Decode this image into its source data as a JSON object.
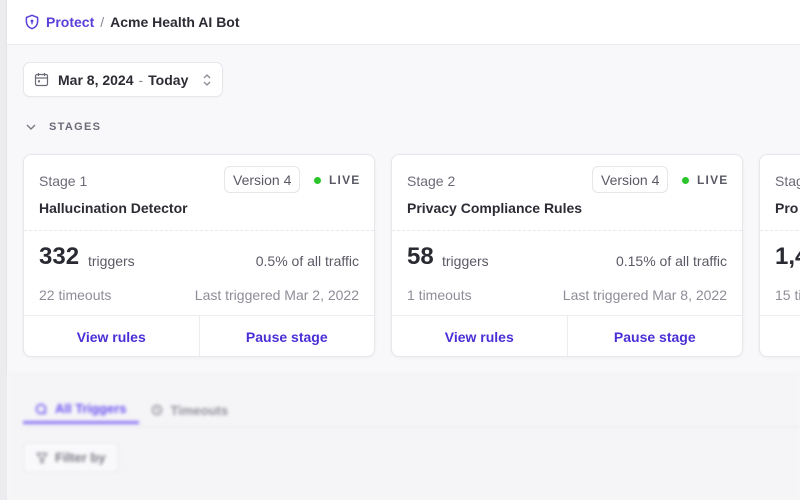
{
  "breadcrumb": {
    "icon": "shield-icon",
    "parent": "Protect",
    "separator": "/",
    "current": "Acme Health AI Bot"
  },
  "date_range": {
    "icon": "calendar-icon",
    "from": "Mar 8, 2024",
    "separator": "-",
    "to": "Today",
    "toggle_icon": "chevron-up-down-icon"
  },
  "stages_section": {
    "label": "STAGES",
    "expanded": true
  },
  "stages": [
    {
      "stage": "Stage 1",
      "name": "Hallucination Detector",
      "version": "Version 4",
      "status": "LIVE",
      "triggers": "332",
      "triggers_label": "triggers",
      "traffic": "0.5% of all traffic",
      "timeouts": "22 timeouts",
      "last_triggered": "Last triggered Mar 2, 2022",
      "view_label": "View rules",
      "pause_label": "Pause stage"
    },
    {
      "stage": "Stage 2",
      "name": "Privacy Compliance Rules",
      "version": "Version 4",
      "status": "LIVE",
      "triggers": "58",
      "triggers_label": "triggers",
      "traffic": "0.15% of all traffic",
      "timeouts": "1 timeouts",
      "last_triggered": "Last triggered Mar 8, 2022",
      "view_label": "View rules",
      "pause_label": "Pause stage"
    },
    {
      "stage": "Stag",
      "name": "Pro",
      "triggers": "1,4",
      "timeouts": "15 ti"
    }
  ],
  "tabs": [
    {
      "label": "All Triggers",
      "icon": "triggers-icon",
      "active": true
    },
    {
      "label": "Timeouts",
      "icon": "clock-icon",
      "active": false
    }
  ],
  "filter": {
    "label": "Filter by",
    "icon": "filter-icon"
  },
  "colors": {
    "accent": "#5b3fd9",
    "live": "#2bc42b"
  }
}
